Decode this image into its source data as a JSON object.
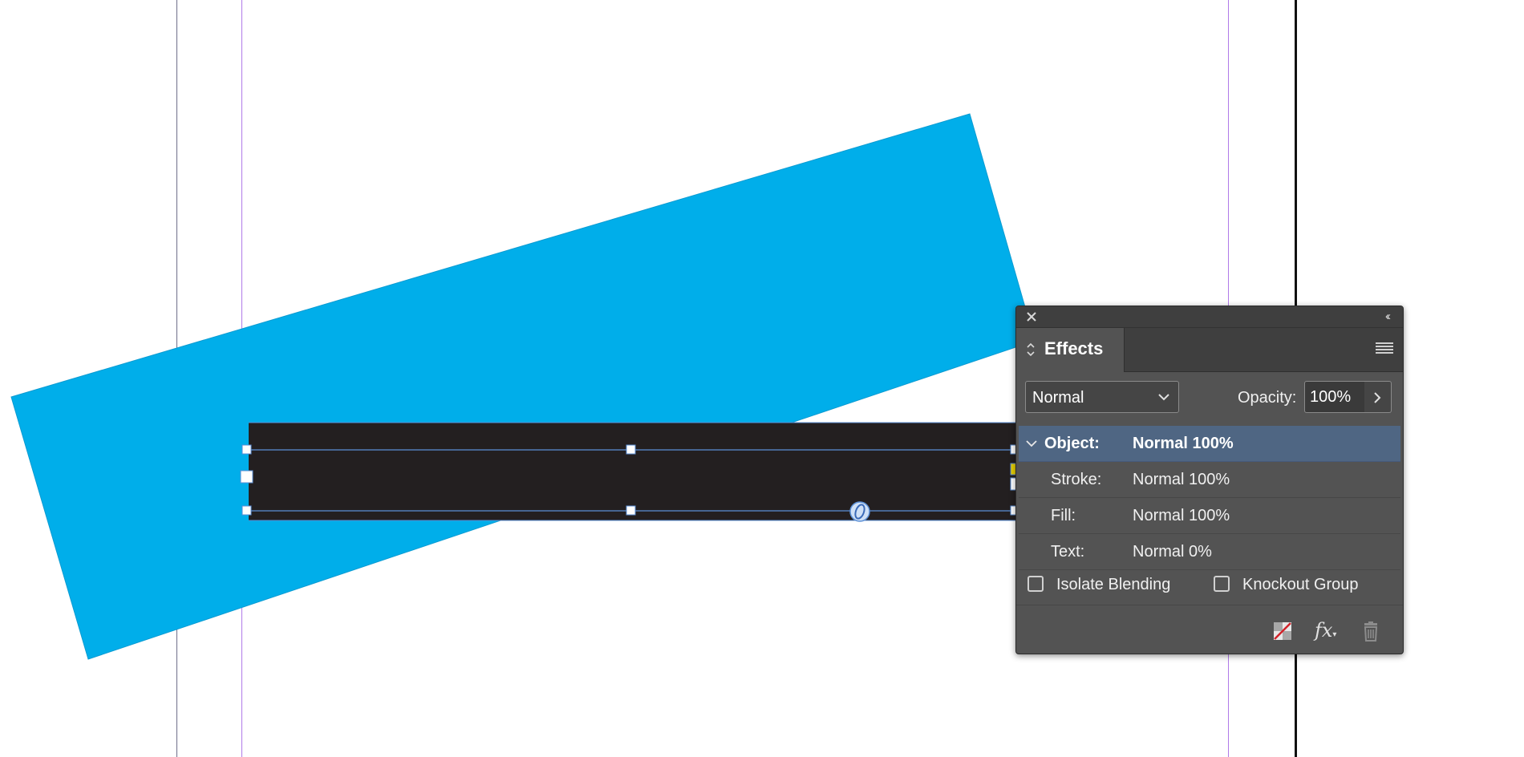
{
  "panel": {
    "close_icon": "close-icon",
    "collapse_label": "‹‹",
    "tab": {
      "label": "Effects",
      "icon": "tab-arrows-icon"
    },
    "menu_icon": "hamburger-menu-icon",
    "blend_mode": {
      "value": "Normal"
    },
    "opacity": {
      "label": "Opacity:",
      "value": "100%"
    },
    "effects": [
      {
        "label": "Object:",
        "value": "Normal 100%",
        "selected": true
      },
      {
        "label": "Stroke:",
        "value": "Normal 100%",
        "selected": false
      },
      {
        "label": "Fill:",
        "value": "Normal 100%",
        "selected": false
      },
      {
        "label": "Text:",
        "value": "Normal 0%",
        "selected": false
      }
    ],
    "checkboxes": [
      {
        "label": "Isolate Blending",
        "checked": false
      },
      {
        "label": "Knockout Group",
        "checked": false
      }
    ],
    "footer_icons": [
      "clear-effects-icon",
      "fx-icon",
      "trash-icon"
    ],
    "fx_label": "fx"
  },
  "colors": {
    "cyan_shape": "#00aeea",
    "dark_frame": "#231f20",
    "selection_blue": "#5b8fd6",
    "guide_purple": "#b07ae8",
    "panel_bg": "#535353",
    "selected_row": "#4f6683",
    "anchor_yellow": "#e8d000"
  }
}
